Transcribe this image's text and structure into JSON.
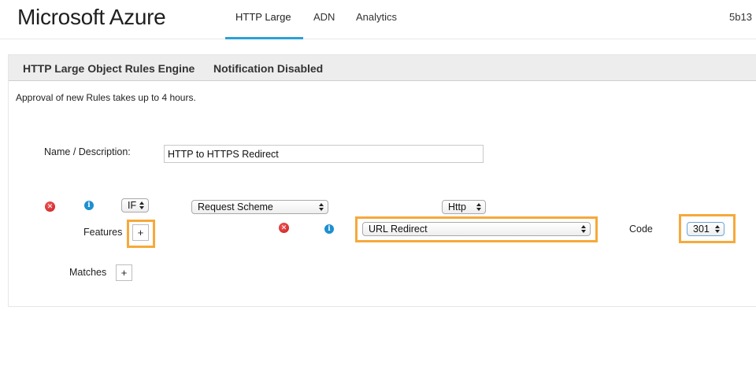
{
  "header": {
    "brand": "Microsoft Azure",
    "tabs": [
      {
        "label": "HTTP Large",
        "active": true
      },
      {
        "label": "ADN",
        "active": false
      },
      {
        "label": "Analytics",
        "active": false
      }
    ],
    "account": "5b13"
  },
  "panel": {
    "title": "HTTP Large Object Rules Engine",
    "notification": "Notification Disabled"
  },
  "approval_note": "Approval of new Rules takes up to 4 hours.",
  "rule": {
    "name_label": "Name / Description:",
    "name_value": "HTTP to HTTPS Redirect",
    "condition_select": "IF",
    "match_select": "Request Scheme",
    "scheme_select": "Http",
    "features_label": "Features",
    "add_label": "+",
    "feature_select": "URL Redirect",
    "code_label": "Code",
    "code_select": "301",
    "matches_label": "Matches"
  },
  "colors": {
    "accent": "#2aa0d6",
    "highlight": "#f6a93a",
    "delete_icon": "#d32a2a",
    "info_icon": "#1d8fd1"
  },
  "icons": {
    "delete": "delete-icon",
    "info": "info-icon"
  }
}
